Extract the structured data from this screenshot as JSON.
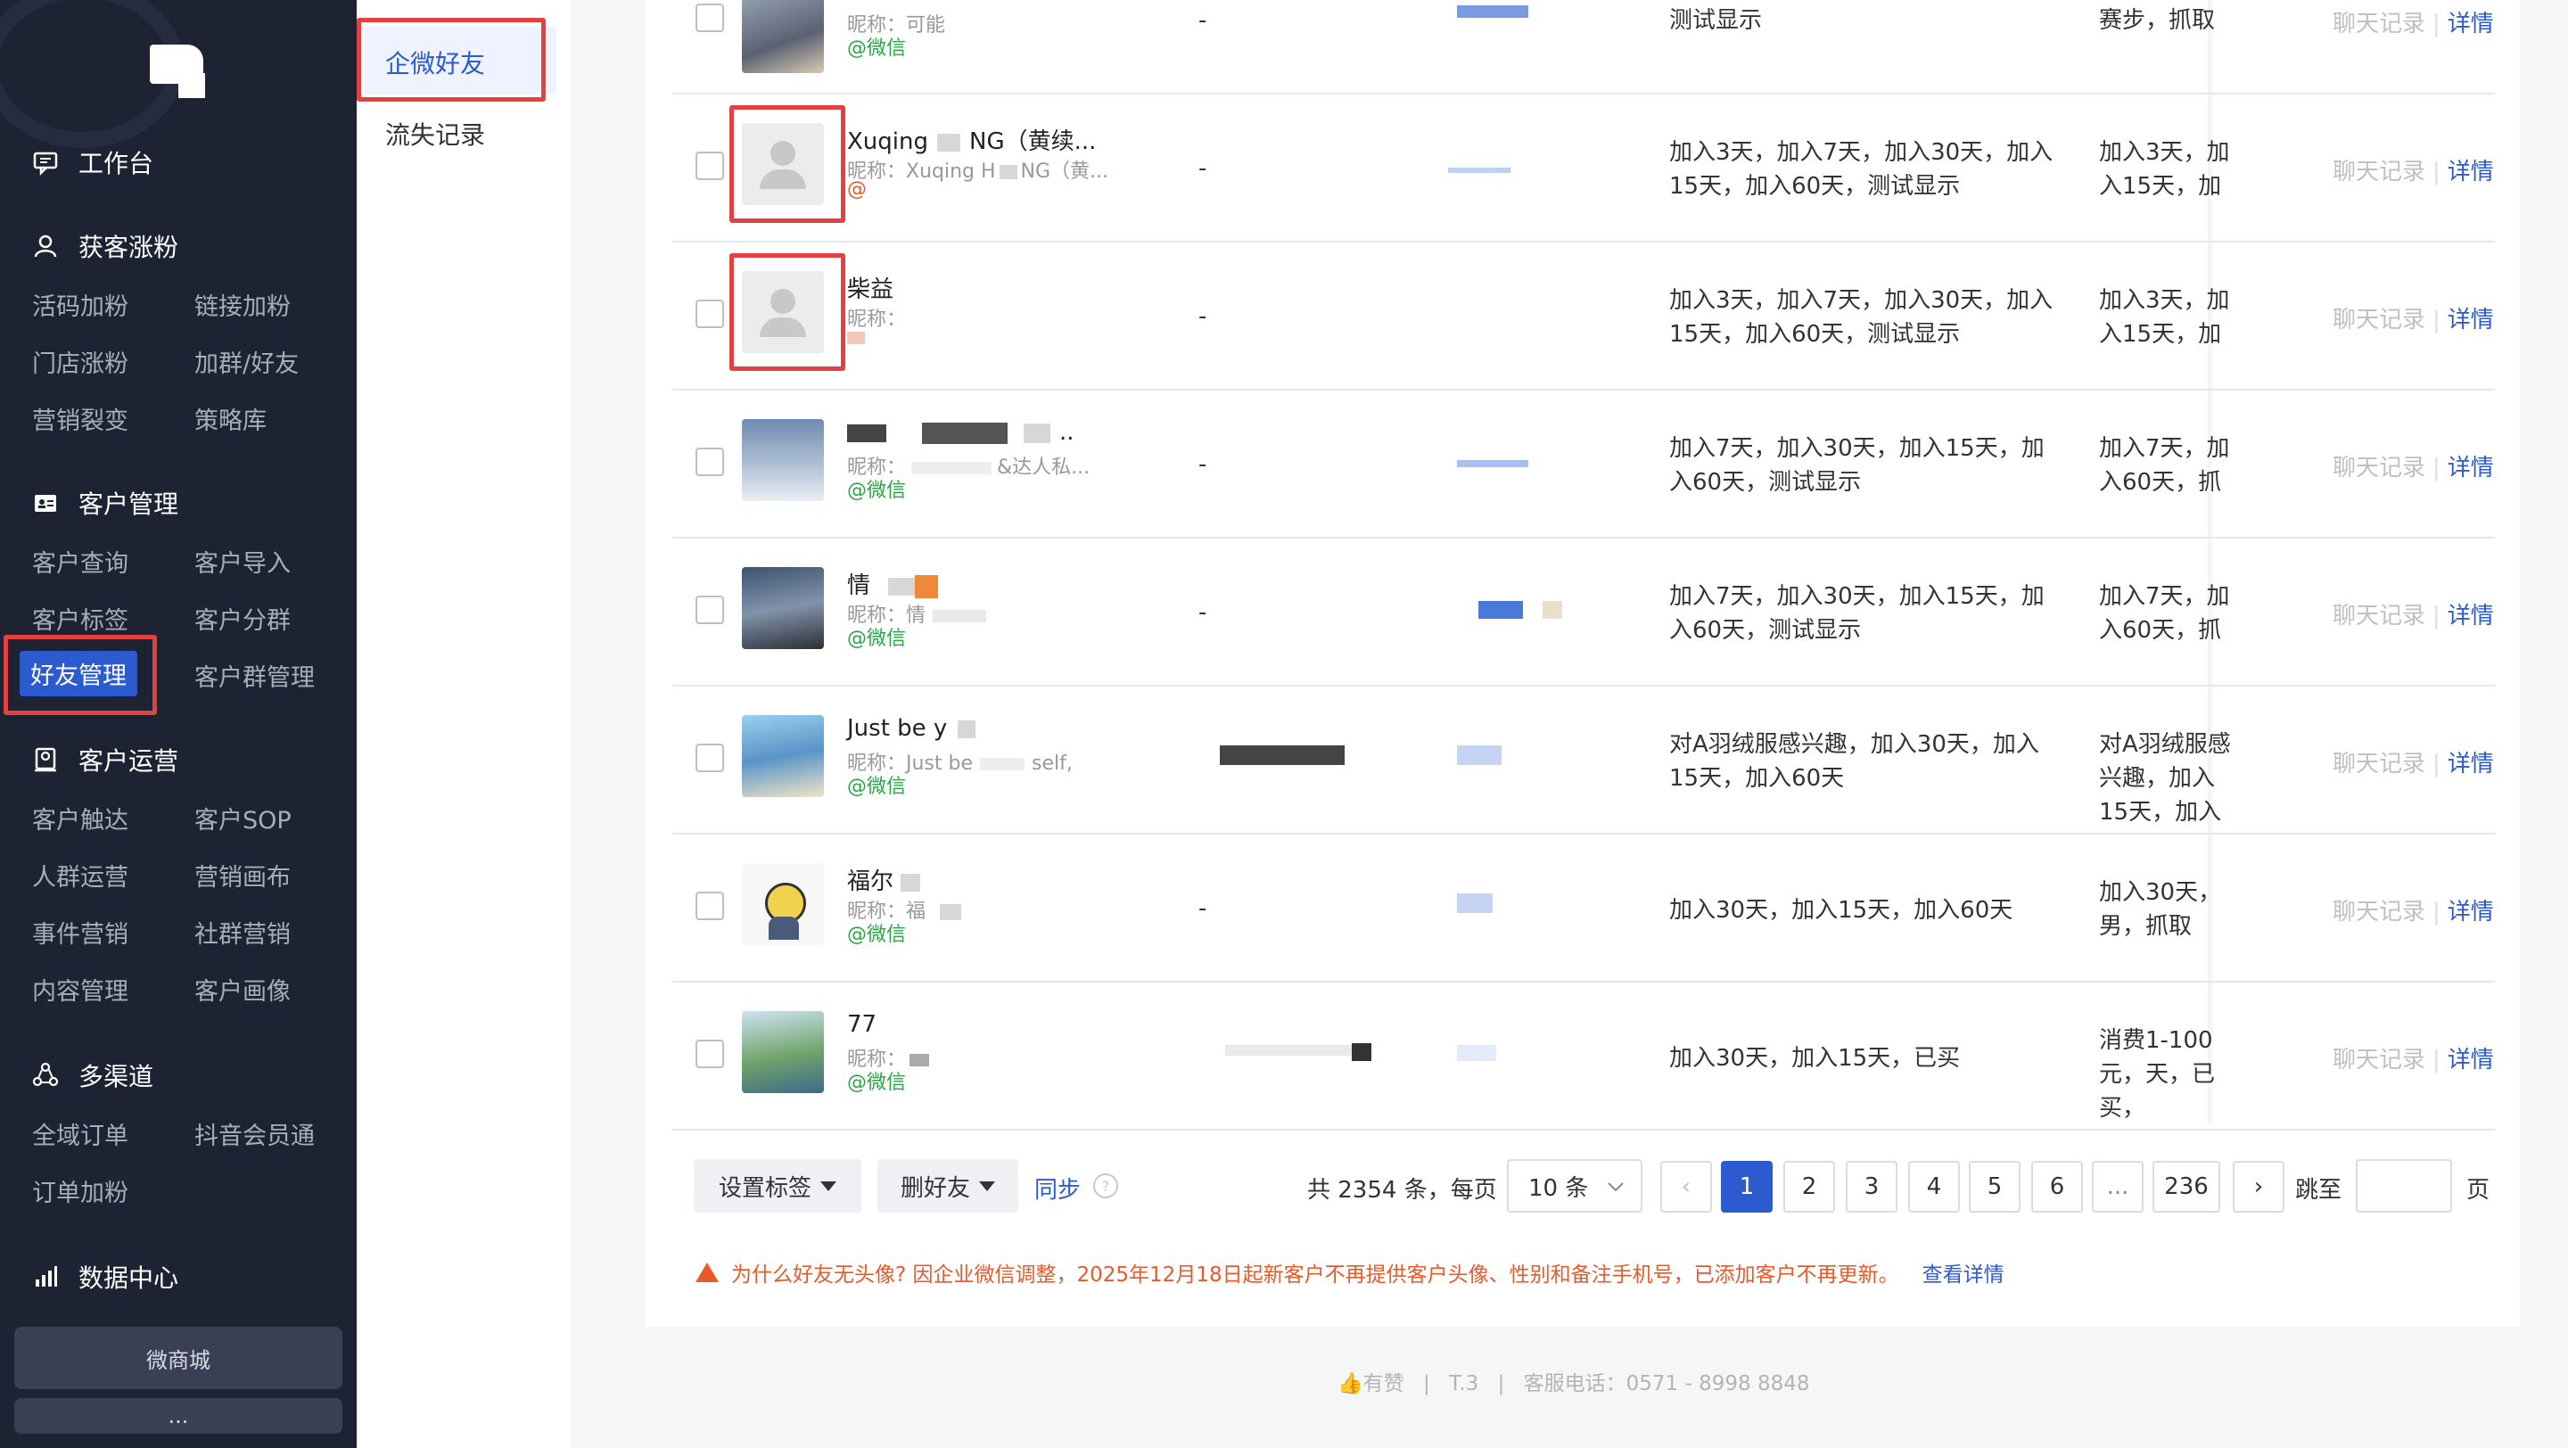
{
  "sidebar": {
    "workbench": "工作台",
    "sections": [
      {
        "title": "获客涨粉",
        "items": [
          "活码加粉",
          "链接加粉",
          "门店涨粉",
          "加群/好友",
          "营销裂变",
          "策略库"
        ]
      },
      {
        "title": "客户管理",
        "items": [
          "客户查询",
          "客户导入",
          "客户标签",
          "客户分群",
          "好友管理",
          "客户群管理"
        ]
      },
      {
        "title": "客户运营",
        "items": [
          "客户触达",
          "客户SOP",
          "人群运营",
          "营销画布",
          "事件营销",
          "社群营销",
          "内容管理",
          "客户画像"
        ]
      },
      {
        "title": "多渠道",
        "items": [
          "全域订单",
          "抖音会员通",
          "订单加粉"
        ]
      },
      {
        "title": "数据中心",
        "items": []
      }
    ],
    "shop": "微商城",
    "more": "..."
  },
  "subnav": [
    "企微好友",
    "流失记录"
  ],
  "rows": [
    {
      "name": "",
      "nick": "昵称：可能",
      "source": "@微信",
      "mobile": "-",
      "staff": "",
      "tags": "测试显示",
      "tags2": "赛步，抓取"
    },
    {
      "name": "Xuqing",
      "name_tail": "NG（黄续...",
      "nick": "昵称：Xuqing H",
      "nick_tail": "NG（黄...",
      "source": "@",
      "mobile": "-",
      "staff": "",
      "tags": "加入3天，加入7天，加入30天，加入15天，加入60天，测试显示",
      "tags2": "加入3天，加入15天，加"
    },
    {
      "name": "柴益",
      "nick": "昵称：",
      "source": "",
      "mobile": "-",
      "staff": "",
      "tags": "加入3天，加入7天，加入30天，加入15天，加入60天，测试显示",
      "tags2": "加入3天，加入15天，加"
    },
    {
      "name": "",
      "name_tail": "..",
      "nick": "昵称：",
      "nick_tail": "&达人私...",
      "source": "@微信",
      "mobile": "-",
      "staff": "",
      "tags": "加入7天，加入30天，加入15天，加入60天，测试显示",
      "tags2": "加入7天，加入60天，抓"
    },
    {
      "name": "情",
      "nick": "昵称：情",
      "source": "@微信",
      "mobile": "-",
      "staff": "",
      "tags": "加入7天，加入30天，加入15天，加入60天，测试显示",
      "tags2": "加入7天，加入60天，抓"
    },
    {
      "name": "Just be y",
      "nick": "昵称：Just be",
      "nick_tail": "self,",
      "source": "@微信",
      "mobile": "",
      "staff": "",
      "tags": "对A羽绒服感兴趣，加入30天，加入15天，加入60天",
      "tags2": "对A羽绒服感兴趣，加入15天，加入"
    },
    {
      "name": "福尔",
      "nick": "昵称：福",
      "source": "@微信",
      "mobile": "-",
      "staff": "",
      "tags": "加入30天，加入15天，加入60天",
      "tags2": "加入30天，男，抓取"
    },
    {
      "name": "77",
      "nick": "昵称：",
      "source": "@微信",
      "mobile": "",
      "staff": "",
      "tags": "加入30天，加入15天，已买",
      "tags2": "消费1-100元，天，已买，"
    }
  ],
  "ops": {
    "chat": "聊天记录",
    "sep": "|",
    "detail": "详情"
  },
  "bottom": {
    "set_tag": "设置标签",
    "delete_friend": "删好友",
    "sync": "同步",
    "sync_help": "?",
    "total": "共 2354 条，每页",
    "page_size": "10 条",
    "pages": [
      "1",
      "2",
      "3",
      "4",
      "5",
      "6",
      "...",
      "236"
    ],
    "prev": "‹",
    "next": "›",
    "jump": "跳至",
    "page_suffix": "页"
  },
  "warning": {
    "text": "为什么好友无头像? 因企业微信调整，2025年12月18日起新客户不再提供客户头像、性别和备注手机号，已添加客户不再更新。",
    "link": "查看详情"
  },
  "footer": {
    "brand": "有赞",
    "version": "T.3",
    "phone": "客服电话：0571 - 8998 8848",
    "sep": "|"
  },
  "colors": {
    "sidebar_bg": "#1d2333",
    "accent": "#2c5bd0",
    "highlight_box": "#e34040",
    "wechat_green": "#27a844",
    "warning": "#e85a2a"
  }
}
